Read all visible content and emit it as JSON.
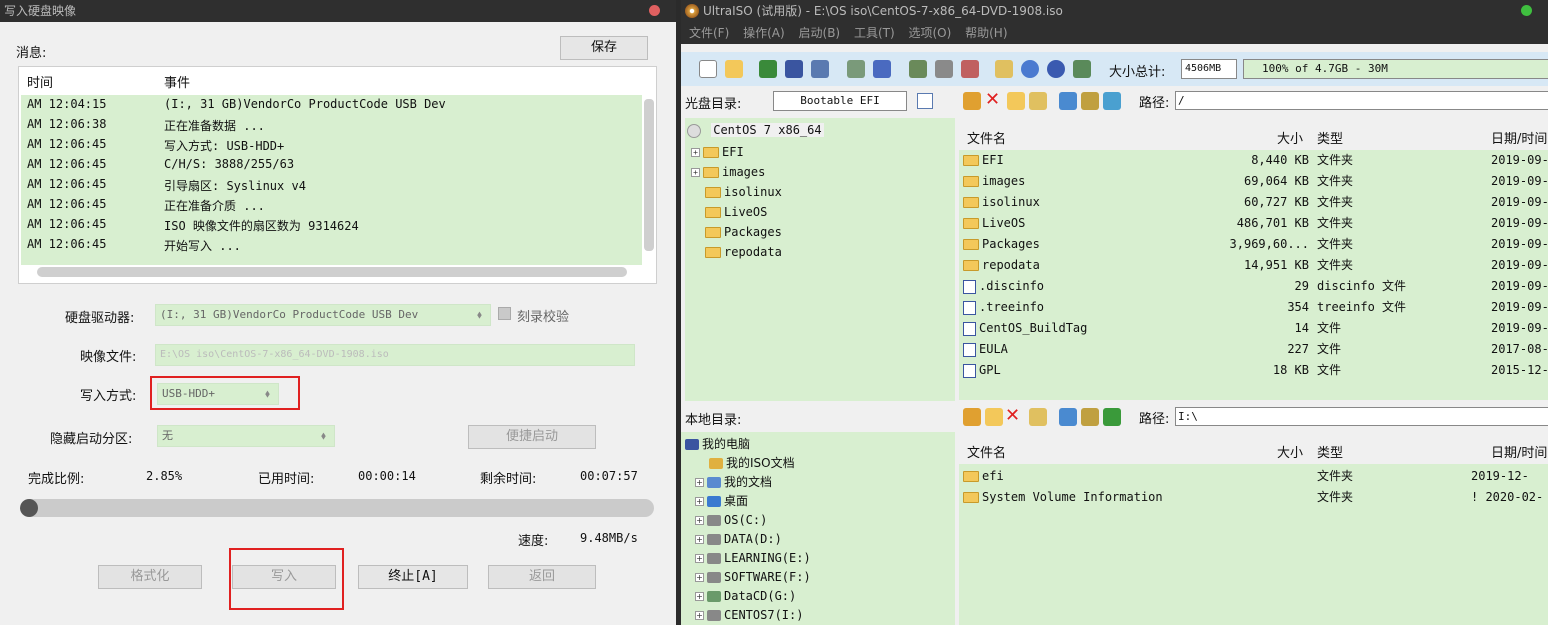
{
  "dialog": {
    "title": "写入硬盘映像",
    "message_label": "消息:",
    "save_button": "保存",
    "log_headers": {
      "time": "时间",
      "event": "事件"
    },
    "log": [
      {
        "time": "AM 12:04:15",
        "event": "(I:, 31 GB)VendorCo ProductCode USB Dev"
      },
      {
        "time": "AM 12:06:38",
        "event": "正在准备数据 ..."
      },
      {
        "time": "AM 12:06:45",
        "event": "写入方式: USB-HDD+"
      },
      {
        "time": "AM 12:06:45",
        "event": "C/H/S: 3888/255/63"
      },
      {
        "time": "AM 12:06:45",
        "event": "引导扇区: Syslinux v4"
      },
      {
        "time": "AM 12:06:45",
        "event": "正在准备介质 ..."
      },
      {
        "time": "AM 12:06:45",
        "event": "ISO 映像文件的扇区数为 9314624"
      },
      {
        "time": "AM 12:06:45",
        "event": "开始写入 ..."
      }
    ],
    "drive_label": "硬盘驱动器:",
    "drive_value": "(I:, 31 GB)VendorCo ProductCode USB Dev",
    "verify_label": "刻录校验",
    "image_label": "映像文件:",
    "image_value": "E:\\OS iso\\CentOS-7-x86_64-DVD-1908.iso",
    "write_method_label": "写入方式:",
    "write_method_value": "USB-HDD+",
    "hidden_partition_label": "隐藏启动分区:",
    "hidden_partition_value": "无",
    "quick_boot_button": "便捷启动",
    "progress_label": "完成比例:",
    "progress_value": "2.85%",
    "progress_fraction": 0.0285,
    "elapsed_label": "已用时间:",
    "elapsed_value": "00:00:14",
    "remaining_label": "剩余时间:",
    "remaining_value": "00:07:57",
    "speed_label": "速度:",
    "speed_value": "9.48MB/s",
    "buttons": {
      "format": "格式化",
      "write": "写入",
      "abort": "终止[A]",
      "back": "返回"
    }
  },
  "ultraiso": {
    "title": "UltraISO (试用版) - E:\\OS iso\\CentOS-7-x86_64-DVD-1908.iso",
    "menu": [
      "文件(F)",
      "操作(A)",
      "启动(B)",
      "工具(T)",
      "选项(O)",
      "帮助(H)"
    ],
    "size_total_label": "大小总计:",
    "size_total_value": "4506MB",
    "capacity_text": "100% of 4.7GB - 30M",
    "cd_dir_label": "光盘目录:",
    "cd_dir_value": "Bootable EFI",
    "path_label": "路径:",
    "cd_path": "/",
    "cd_tree": [
      "CentOS 7 x86_64",
      "EFI",
      "images",
      "isolinux",
      "LiveOS",
      "Packages",
      "repodata"
    ],
    "columns": {
      "name": "文件名",
      "size": "大小",
      "type": "类型",
      "date": "日期/时间"
    },
    "cd_files": [
      {
        "name": "EFI",
        "size": "8,440 KB",
        "type": "文件夹",
        "date": "2019-09-"
      },
      {
        "name": "images",
        "size": "69,064 KB",
        "type": "文件夹",
        "date": "2019-09-"
      },
      {
        "name": "isolinux",
        "size": "60,727 KB",
        "type": "文件夹",
        "date": "2019-09-"
      },
      {
        "name": "LiveOS",
        "size": "486,701 KB",
        "type": "文件夹",
        "date": "2019-09-"
      },
      {
        "name": "Packages",
        "size": "3,969,60...",
        "type": "文件夹",
        "date": "2019-09-"
      },
      {
        "name": "repodata",
        "size": "14,951 KB",
        "type": "文件夹",
        "date": "2019-09-"
      },
      {
        "name": ".discinfo",
        "size": "29",
        "type": "discinfo 文件",
        "date": "2019-09-"
      },
      {
        "name": ".treeinfo",
        "size": "354",
        "type": "treeinfo 文件",
        "date": "2019-09-"
      },
      {
        "name": "CentOS_BuildTag",
        "size": "14",
        "type": "文件",
        "date": "2019-09-"
      },
      {
        "name": "EULA",
        "size": "227",
        "type": "文件",
        "date": "2017-08-"
      },
      {
        "name": "GPL",
        "size": "18 KB",
        "type": "文件",
        "date": "2015-12-"
      }
    ],
    "local_dir_label": "本地目录:",
    "local_path": "I:\\",
    "local_tree": [
      "我的电脑",
      "我的ISO文档",
      "我的文档",
      "桌面",
      "OS(C:)",
      "DATA(D:)",
      "LEARNING(E:)",
      "SOFTWARE(F:)",
      "DataCD(G:)",
      "CENTOS7(I:)"
    ],
    "local_files": [
      {
        "name": "efi",
        "size": "",
        "type": "文件夹",
        "date": "2019-12-"
      },
      {
        "name": "System Volume Information",
        "size": "",
        "type": "文件夹",
        "date": "! 2020-02-"
      }
    ]
  }
}
